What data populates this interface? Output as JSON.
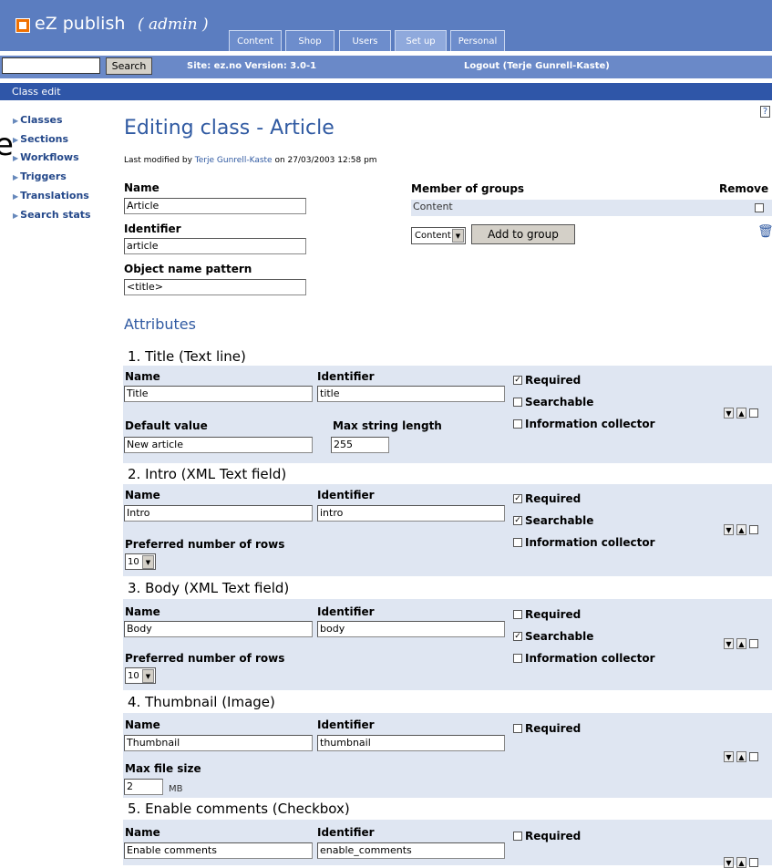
{
  "header": {
    "logo_text": "eZ publish",
    "logo_suffix": "( admin )",
    "tabs": [
      "Content",
      "Shop",
      "Users",
      "Set up",
      "Personal"
    ],
    "active_tab": "Set up"
  },
  "searchbar": {
    "search_value": "",
    "search_button": "Search",
    "site_info": "Site: ez.no Version: 3.0-1",
    "logout": "Logout (Terje Gunrell-Kaste)"
  },
  "breadcrumb": "Class edit",
  "sidebar": {
    "items": [
      "Classes",
      "Sections",
      "Workflows",
      "Triggers",
      "Translations",
      "Search stats"
    ],
    "stray_text": "e"
  },
  "main": {
    "title": "Editing class - Article",
    "help_label": "?",
    "last_modified_prefix": "Last modified by",
    "last_modified_user": "Terje Gunrell-Kaste",
    "last_modified_suffix": "on 27/03/2003 12:58 pm",
    "name_label": "Name",
    "name_value": "Article",
    "identifier_label": "Identifier",
    "identifier_value": "article",
    "pattern_label": "Object name pattern",
    "pattern_value": "<title>",
    "groups_header": "Member of groups",
    "remove_header": "Remove",
    "groups": [
      "Content"
    ],
    "group_select_value": "Content",
    "add_group_button": "Add to group",
    "attributes_title": "Attributes"
  },
  "labels": {
    "name": "Name",
    "identifier": "Identifier",
    "default_value": "Default value",
    "max_string_length": "Max string length",
    "preferred_rows": "Preferred number of rows",
    "max_file_size": "Max file size",
    "mb": "MB",
    "required": "Required",
    "searchable": "Searchable",
    "info_collector": "Information collector"
  },
  "attributes": [
    {
      "title": "1. Title (Text line)",
      "name": "Title",
      "identifier": "title",
      "default_value": "New article",
      "max_length": "255",
      "required": true,
      "searchable": false,
      "info_collector": false
    },
    {
      "title": "2. Intro (XML Text field)",
      "name": "Intro",
      "identifier": "intro",
      "rows": "10",
      "required": true,
      "searchable": true,
      "info_collector": false
    },
    {
      "title": "3. Body (XML Text field)",
      "name": "Body",
      "identifier": "body",
      "rows": "10",
      "required": false,
      "searchable": true,
      "info_collector": false
    },
    {
      "title": "4. Thumbnail (Image)",
      "name": "Thumbnail",
      "identifier": "thumbnail",
      "max_file_size": "2",
      "required": false
    },
    {
      "title": "5. Enable comments (Checkbox)",
      "name": "Enable comments",
      "identifier": "enable_comments",
      "required": false
    }
  ],
  "colors": {
    "header": "#5b7dc0",
    "breadcrumb_bar": "#2f56a8",
    "link": "#305aa2",
    "panel": "#dfe6f2",
    "logo": "#f07000"
  }
}
